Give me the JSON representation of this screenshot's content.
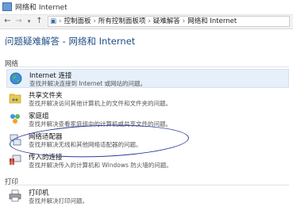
{
  "window": {
    "title": "网络和 Internet"
  },
  "nav": {
    "back": "←",
    "forward": "→",
    "up": "↑",
    "breadcrumb": [
      "控制面板",
      "所有控制面板项",
      "疑难解答",
      "网络和 Internet"
    ],
    "separator": "›"
  },
  "page": {
    "title": "问题疑难解答 - 网络和 Internet"
  },
  "sections": [
    {
      "label": "网络",
      "items": [
        {
          "name": "Internet 连接",
          "desc": "查找并解决连接到 Internet 或网站的问题。",
          "icon": "globe-icon"
        },
        {
          "name": "共享文件夹",
          "desc": "查找并解决访问其他计算机上的文件和文件夹的问题。",
          "icon": "shared-folder-icon"
        },
        {
          "name": "家庭组",
          "desc": "查找并解决查看家庭组中的计算机或共享文件的问题。",
          "icon": "homegroup-icon"
        },
        {
          "name": "网络适配器",
          "desc": "查找并解决无线和其他网络适配器的问题。",
          "icon": "network-adapter-icon"
        },
        {
          "name": "传入的连接",
          "desc": "查找并解决传入的计算机和 Windows 防火墙的问题。",
          "icon": "incoming-connection-icon"
        }
      ]
    },
    {
      "label": "打印",
      "items": [
        {
          "name": "打印机",
          "desc": "查找并解决打印问题。",
          "icon": "printer-icon"
        }
      ]
    }
  ],
  "colors": {
    "title": "#1f4e86",
    "annotation": "#2b3a9f",
    "selected": "#e7f0fa"
  }
}
